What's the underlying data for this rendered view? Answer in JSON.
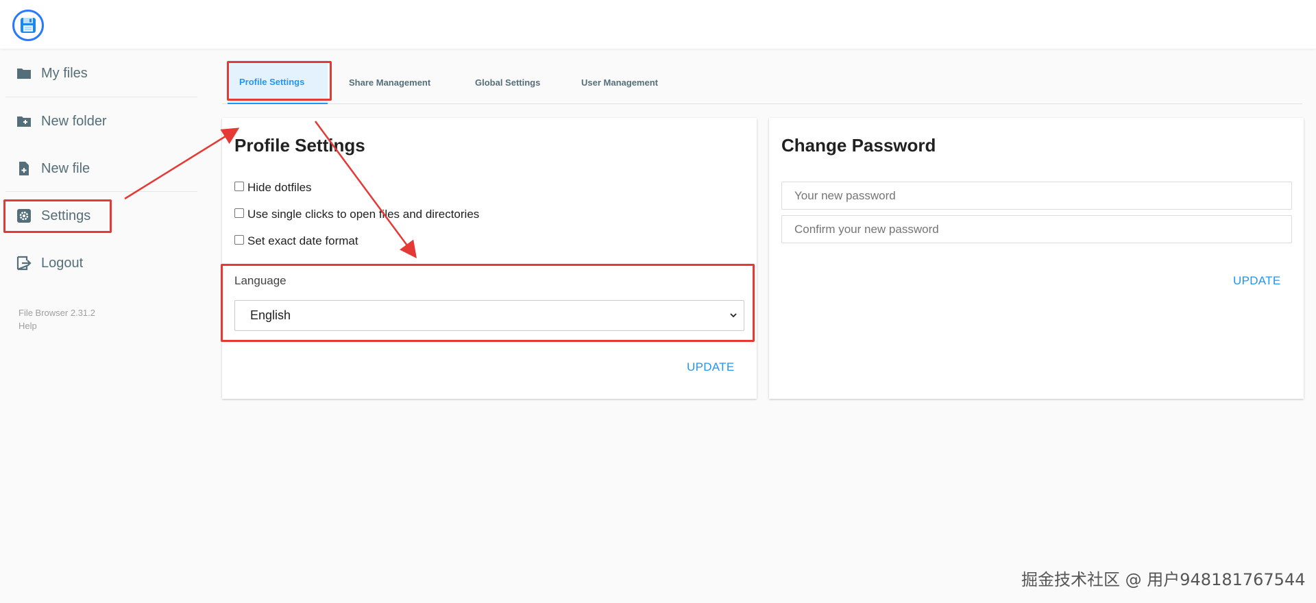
{
  "header": {
    "logo_icon": "floppy-disk-logo"
  },
  "sidebar": {
    "items": [
      {
        "label": "My files",
        "icon": "folder-icon"
      },
      {
        "label": "New folder",
        "icon": "new-folder-icon"
      },
      {
        "label": "New file",
        "icon": "new-file-icon"
      },
      {
        "label": "Settings",
        "icon": "gear-icon"
      },
      {
        "label": "Logout",
        "icon": "logout-icon"
      }
    ],
    "version": "File Browser 2.31.2",
    "help": "Help"
  },
  "tabs": [
    {
      "label": "Profile Settings",
      "active": true
    },
    {
      "label": "Share Management",
      "active": false
    },
    {
      "label": "Global Settings",
      "active": false
    },
    {
      "label": "User Management",
      "active": false
    }
  ],
  "profile": {
    "title": "Profile Settings",
    "options": [
      {
        "label": "Hide dotfiles",
        "checked": false
      },
      {
        "label": "Use single clicks to open files and directories",
        "checked": false
      },
      {
        "label": "Set exact date format",
        "checked": false
      }
    ],
    "language_label": "Language",
    "language_value": "English",
    "update_label": "UPDATE"
  },
  "password": {
    "title": "Change Password",
    "new_placeholder": "Your new password",
    "confirm_placeholder": "Confirm your new password",
    "update_label": "UPDATE"
  },
  "colors": {
    "accent": "#2196f3",
    "annotation": "#e53935",
    "nav_text": "#546e7a"
  },
  "watermark": "掘金技术社区 @ 用户948181767544"
}
